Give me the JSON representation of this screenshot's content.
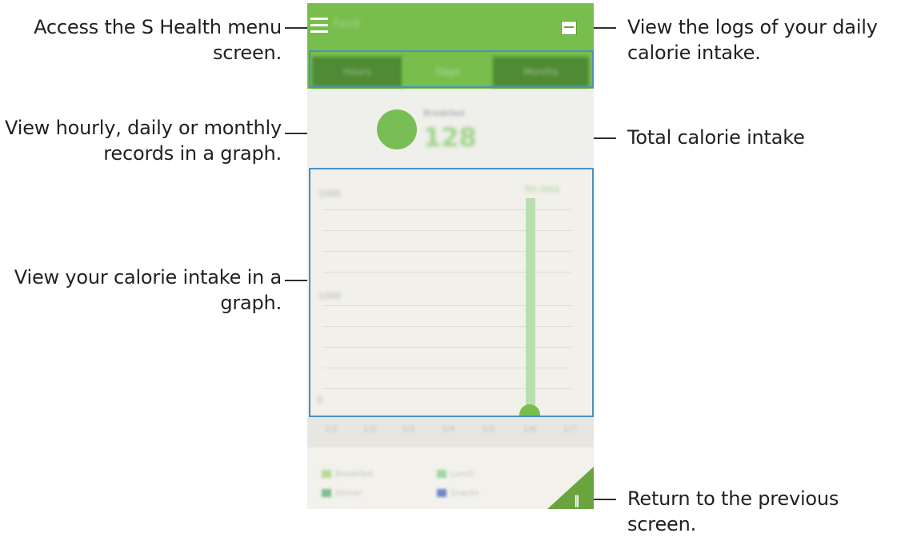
{
  "callouts": {
    "menu": "Access the S Health menu screen.",
    "logs": "View the logs of your daily calorie intake.",
    "records": "View hourly, daily or monthly records in a graph.",
    "total": "Total calorie intake",
    "graph": "View your calorie intake in a graph.",
    "back": "Return to the previous screen."
  },
  "screen": {
    "title": "Food",
    "tabs": [
      "Hours",
      "Days",
      "Months"
    ],
    "selected_tab": "Days",
    "intake_label": "Breakfast",
    "intake_value": "128",
    "graph_hint": "No data",
    "graph_ylabels": [
      "2000",
      "1000",
      "0"
    ],
    "xticks": [
      "1/1",
      "1/2",
      "1/3",
      "1/4",
      "1/5",
      "1/6",
      "1/7"
    ],
    "legend": [
      "Breakfast",
      "Lunch",
      "Dinner",
      "Snacks"
    ],
    "colors": {
      "accent": "#78be4d",
      "dark_accent": "#4f8a34",
      "highlight_box": "#4a8fc4"
    },
    "icons": {
      "menu": "menu-icon",
      "logs": "log-icon",
      "back": "fork-knife-icon"
    }
  }
}
